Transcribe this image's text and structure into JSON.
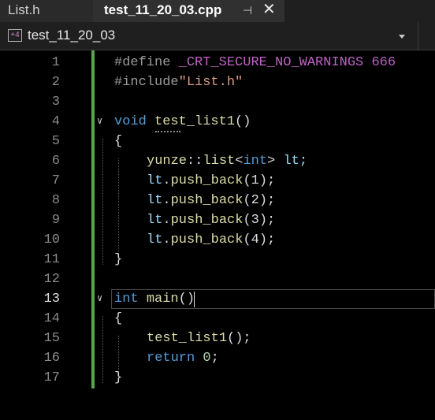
{
  "tabs": [
    {
      "label": "List.h"
    },
    {
      "label": "test_11_20_03.cpp",
      "pin": "⊣",
      "close": "✕"
    }
  ],
  "navbar": {
    "scope": "test_11_20_03",
    "icon": "+4"
  },
  "lines": [
    {
      "n": "1"
    },
    {
      "n": "2"
    },
    {
      "n": "3"
    },
    {
      "n": "4"
    },
    {
      "n": "5"
    },
    {
      "n": "6"
    },
    {
      "n": "7"
    },
    {
      "n": "8"
    },
    {
      "n": "9"
    },
    {
      "n": "10"
    },
    {
      "n": "11"
    },
    {
      "n": "12"
    },
    {
      "n": "13"
    },
    {
      "n": "14"
    },
    {
      "n": "15"
    },
    {
      "n": "16"
    },
    {
      "n": "17"
    }
  ],
  "code": {
    "l1_define": "#define",
    "l1_macro": "_CRT_SECURE_NO_WARNINGS",
    "l1_value": "666",
    "l2_include": "#include",
    "l2_file": "\"List.h\"",
    "l4_void": "void",
    "l4_name": "test_list1",
    "l4_parens": "()",
    "brace_open": "{",
    "brace_close": "}",
    "l6_ns": "yunze",
    "l6_sep": "::",
    "l6_type": "list",
    "l6_lt": "<",
    "l6_int": "int",
    "l6_gt": ">",
    "l6_var": " lt;",
    "push": [
      {
        "obj": "lt",
        "dot": ".",
        "fn": "push_back",
        "arg": "(1);"
      },
      {
        "obj": "lt",
        "dot": ".",
        "fn": "push_back",
        "arg": "(2);"
      },
      {
        "obj": "lt",
        "dot": ".",
        "fn": "push_back",
        "arg": "(3);"
      },
      {
        "obj": "lt",
        "dot": ".",
        "fn": "push_back",
        "arg": "(4);"
      }
    ],
    "l13_int": "int",
    "l13_main": "main",
    "l13_parens": "()",
    "l15_call": "test_list1",
    "l15_rest": "();",
    "l16_return": "return",
    "l16_zero": "0",
    "l16_semi": ";"
  },
  "current_line": "13",
  "colors": {
    "keyword": "#569cd6",
    "function": "#dcdcaa",
    "macro": "#bd63c5",
    "string": "#d69d85",
    "change_bar": "#57a64a"
  }
}
